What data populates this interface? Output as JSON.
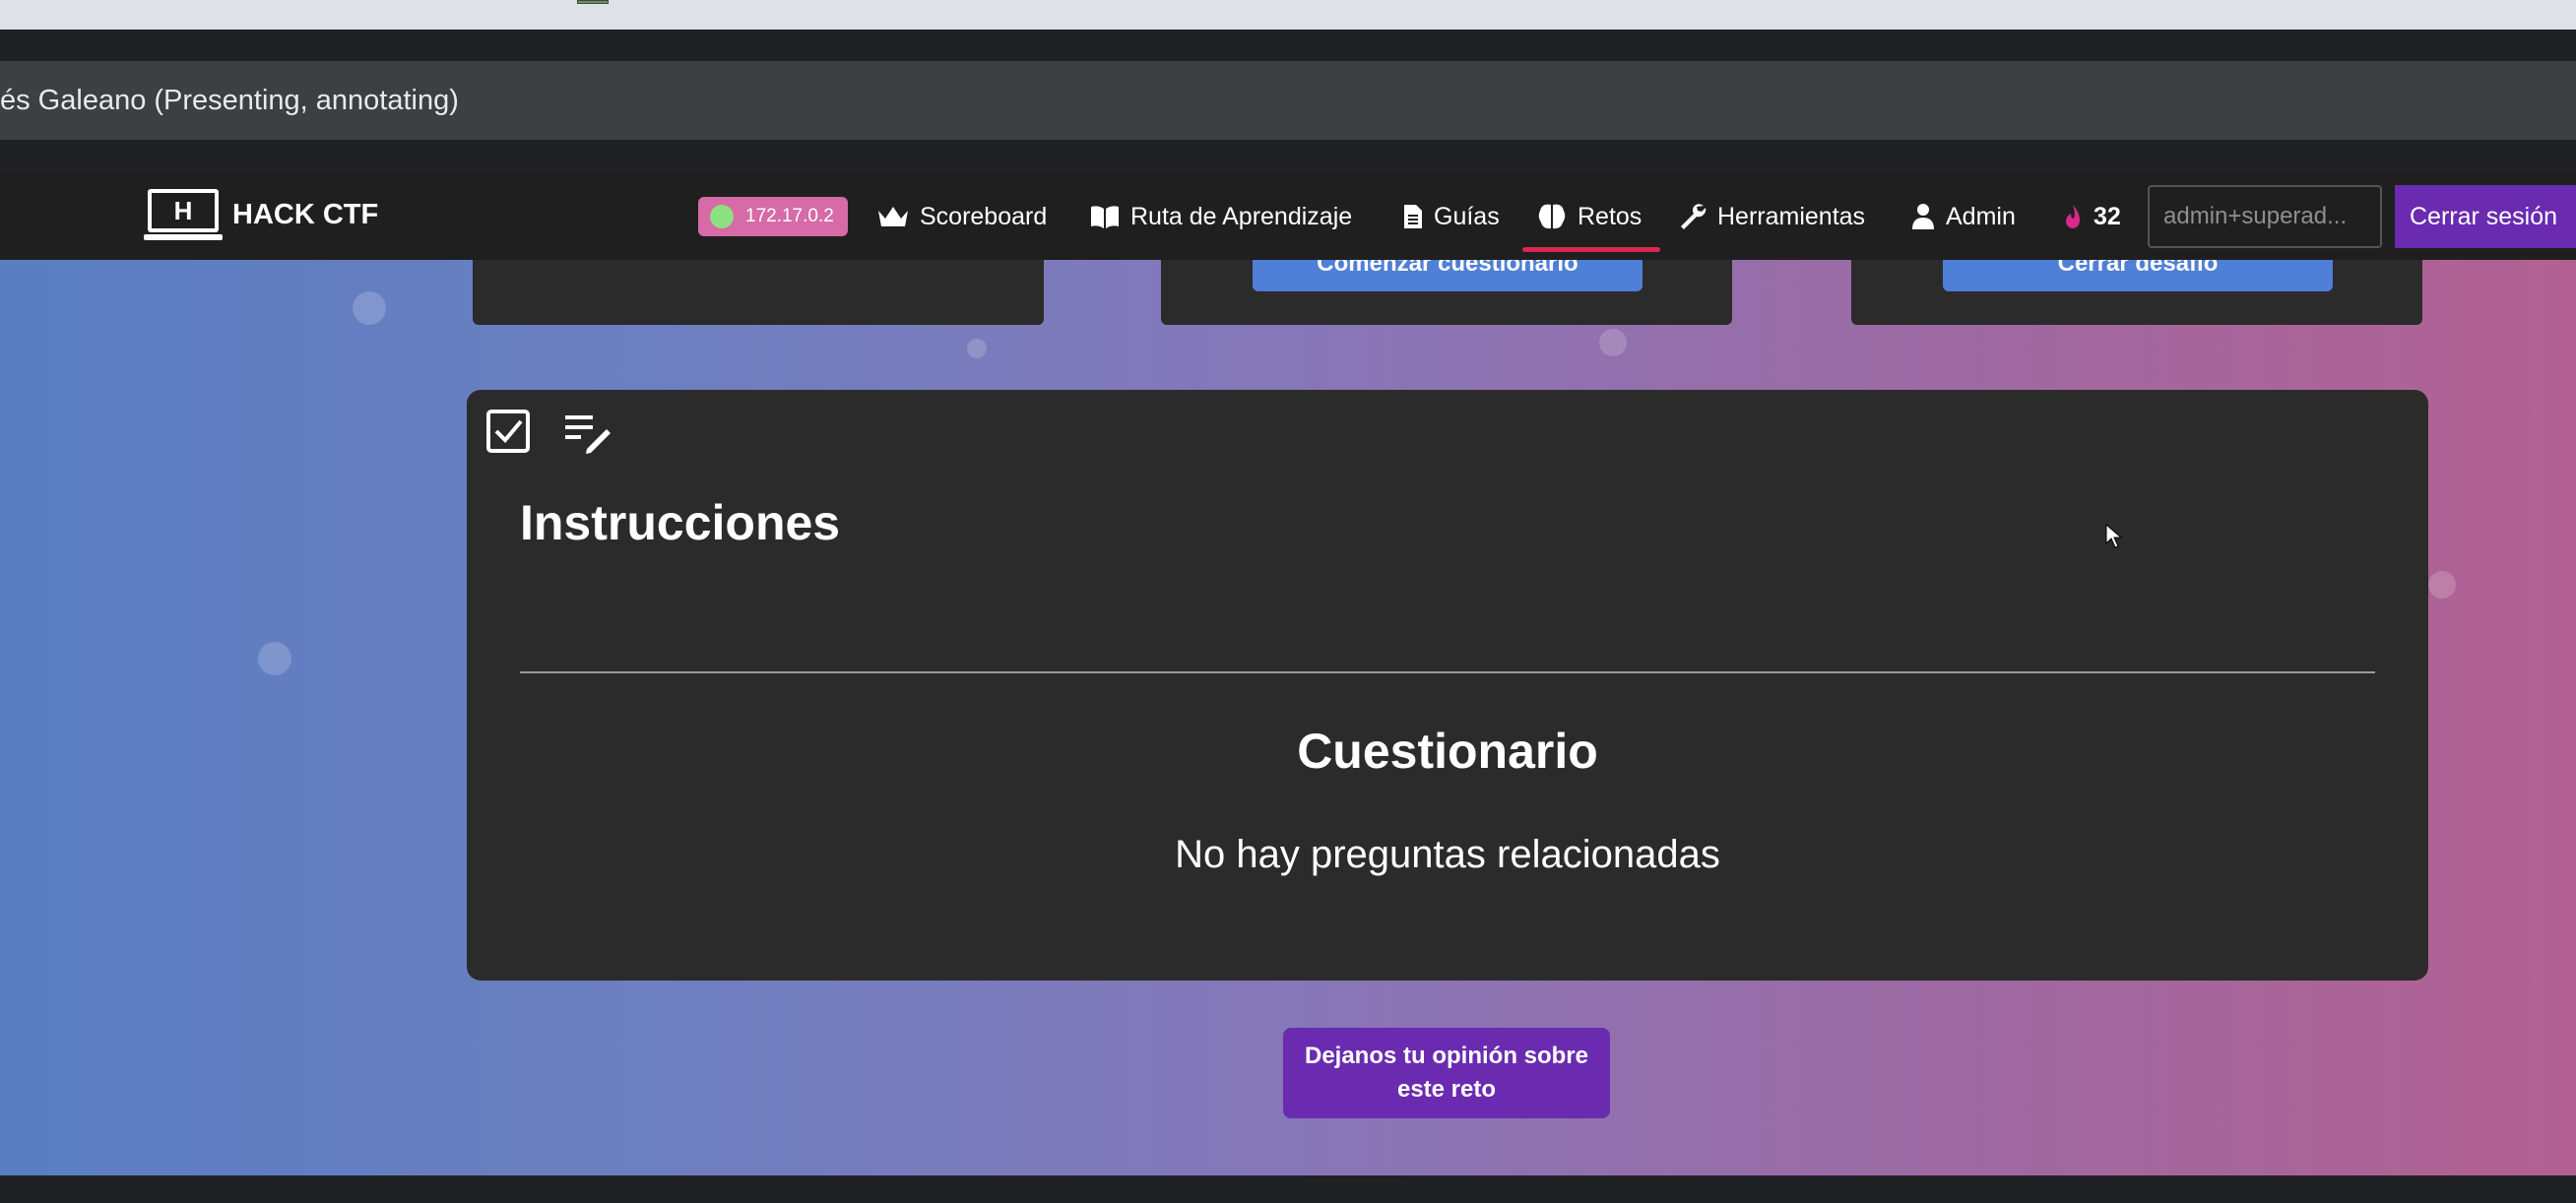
{
  "presenter": {
    "label": "és Galeano (Presenting, annotating)"
  },
  "navbar": {
    "brand_logo_letter": "H",
    "brand_name": "HACK CTF",
    "ip": "172.17.0.2",
    "items": [
      {
        "label": "Scoreboard",
        "icon": "crown-icon"
      },
      {
        "label": "Ruta de Aprendizaje",
        "icon": "book-icon"
      },
      {
        "label": "Guías",
        "icon": "document-icon"
      },
      {
        "label": "Retos",
        "icon": "brain-icon",
        "active": true
      },
      {
        "label": "Herramientas",
        "icon": "wrench-icon"
      },
      {
        "label": "Admin",
        "icon": "user-icon"
      }
    ],
    "streak_count": "32",
    "streak_icon": "flame-icon",
    "user_field_value": "admin+superad...",
    "logout_label": "Cerrar sesión",
    "accent_underline": "#d8294f"
  },
  "top_cards": [
    {
      "button_label": ""
    },
    {
      "button_label": "Comenzar cuestionario"
    },
    {
      "button_label": "Cerrar desafío"
    }
  ],
  "main_card": {
    "toolbar_icons": [
      "checkbox-checked-icon",
      "list-edit-icon"
    ],
    "instructions_title": "Instrucciones",
    "quiz_title": "Cuestionario",
    "empty_message": "No hay preguntas relacionadas"
  },
  "feedback_button": {
    "line1": "Dejanos tu opinión sobre",
    "line2": "este reto"
  },
  "colors": {
    "primary_button": "#6a2bb0",
    "card_background": "#2b2b2b",
    "navbar_background": "#1f1f1f",
    "card_button": "#4f7fd6"
  }
}
